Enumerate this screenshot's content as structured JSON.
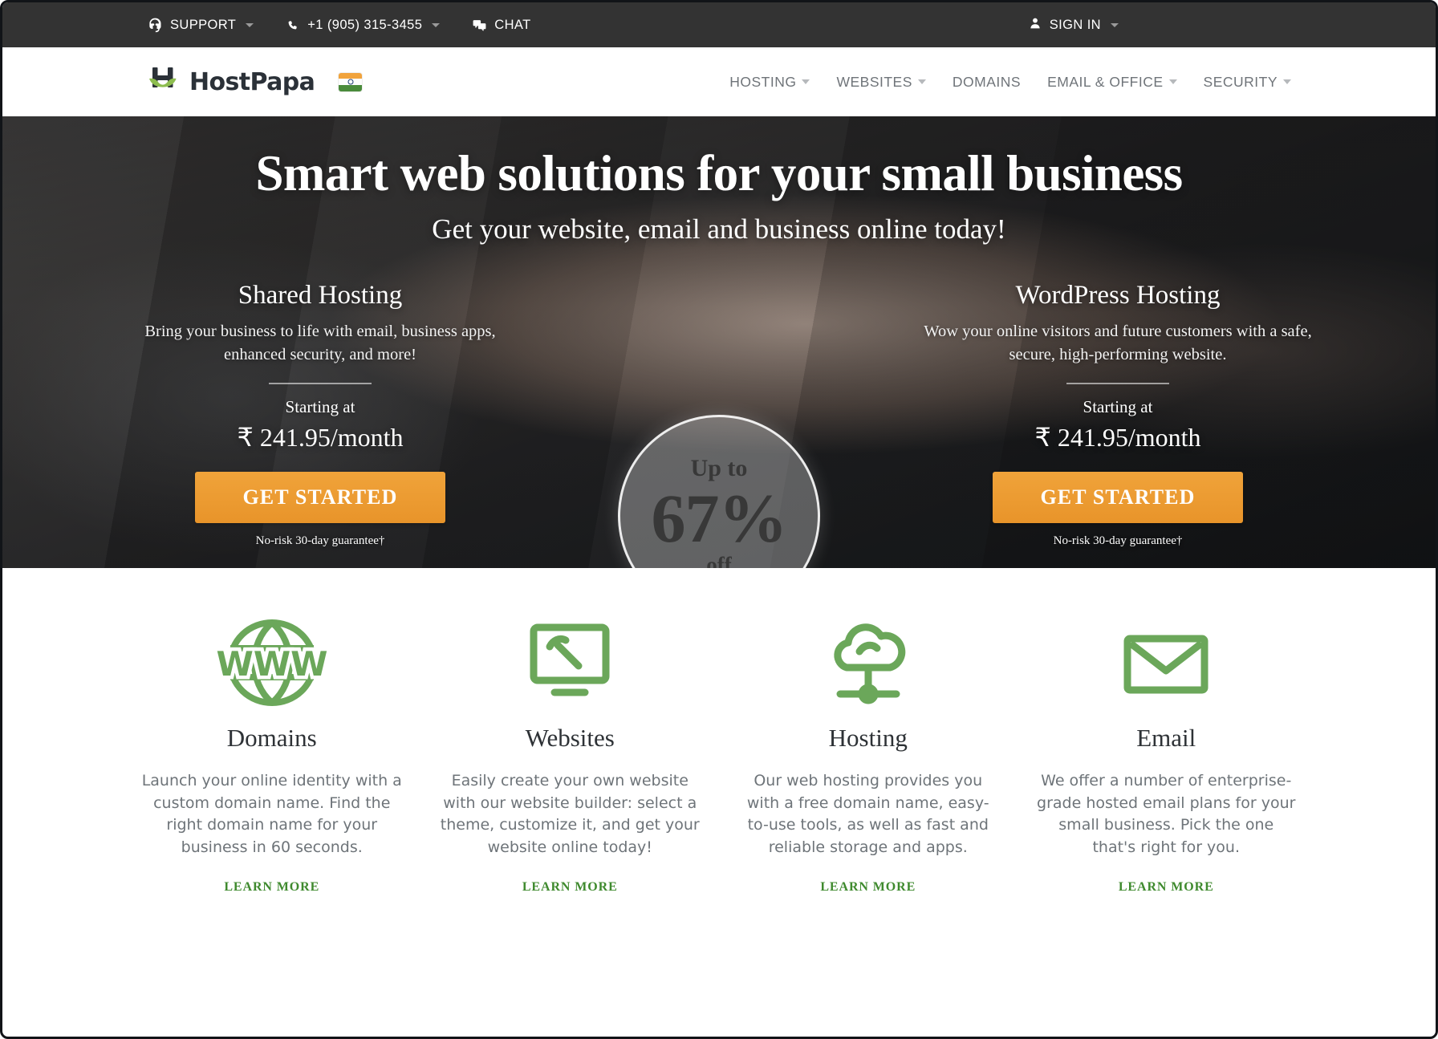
{
  "topbar": {
    "support": {
      "label": "SUPPORT",
      "icon": "support-headset-icon",
      "has_caret": true
    },
    "phone": {
      "label": "+1 (905) 315-3455",
      "icon": "phone-icon",
      "has_caret": true
    },
    "chat": {
      "label": "CHAT",
      "icon": "chat-bubbles-icon",
      "has_caret": false
    },
    "signin": {
      "label": "SIGN IN",
      "icon": "user-icon",
      "has_caret": true
    },
    "bg_color": "#333333"
  },
  "header": {
    "brand_name": "HostPapa",
    "logo_icon": "hostpapa-moustache-logo",
    "locale_flag": "india-flag-icon",
    "nav": [
      {
        "label": "HOSTING",
        "has_caret": true
      },
      {
        "label": "WEBSITES",
        "has_caret": true
      },
      {
        "label": "DOMAINS",
        "has_caret": false
      },
      {
        "label": "EMAIL & OFFICE",
        "has_caret": true
      },
      {
        "label": "SECURITY",
        "has_caret": true
      }
    ]
  },
  "hero": {
    "headline": "Smart web solutions for your small business",
    "subheadline": "Get your website, email and business online today!",
    "badge": {
      "top": "Up to",
      "percent": "67%",
      "bottom": "off"
    },
    "columns": [
      {
        "title": "Shared Hosting",
        "description": "Bring your business to life with email, business apps, enhanced security, and more!",
        "starting_label": "Starting at",
        "price": "₹ 241.95/month",
        "cta": "GET STARTED",
        "guarantee": "No-risk 30-day guarantee†"
      },
      {
        "title": "WordPress Hosting",
        "description": "Wow your online visitors and future customers with a safe, secure, high-performing website.",
        "starting_label": "Starting at",
        "price": "₹ 241.95/month",
        "cta": "GET STARTED",
        "guarantee": "No-risk 30-day guarantee†"
      }
    ],
    "cta_color": "#eb9a2e"
  },
  "features": {
    "accent_color": "#6ba75a",
    "link_color": "#3f8a2e",
    "items": [
      {
        "icon": "globe-www-icon",
        "title": "Domains",
        "description": "Launch your online identity with a custom domain name. Find the right domain name for your business in 60 seconds.",
        "link": "LEARN MORE"
      },
      {
        "icon": "monitor-hammer-builder-icon",
        "title": "Websites",
        "description": "Easily create your own website with our website builder: select a theme, customize it, and get your website online today!",
        "link": "LEARN MORE"
      },
      {
        "icon": "cloud-hosting-network-icon",
        "title": "Hosting",
        "description": "Our web hosting provides you with a free domain name, easy-to-use tools, as well as fast and reliable storage and apps.",
        "link": "LEARN MORE"
      },
      {
        "icon": "envelope-email-icon",
        "title": "Email",
        "description": "We offer a number of enterprise-grade hosted email plans for your small business. Pick the one that's right for you.",
        "link": "LEARN MORE"
      }
    ]
  }
}
